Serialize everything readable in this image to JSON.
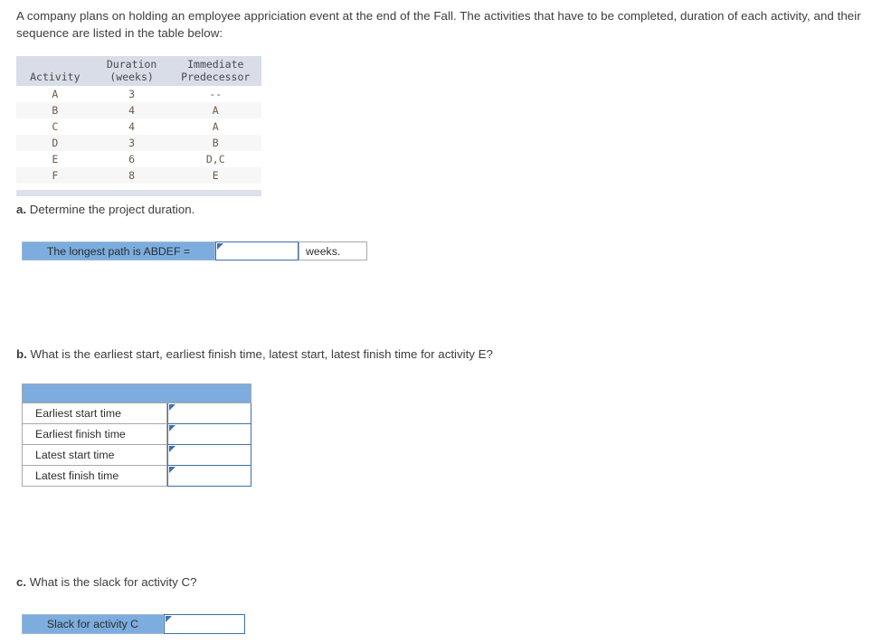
{
  "intro": {
    "paragraph": "A company plans on holding an employee appriciation event at the end of the Fall. The activities that have to be completed, duration of each activity, and their sequence are listed in the table below:"
  },
  "activity_table": {
    "headers": [
      "Activity",
      "Duration (weeks)",
      "Immediate Predecessor"
    ],
    "header_lines": {
      "activity": {
        "line1": "",
        "line2": "Activity"
      },
      "duration": {
        "line1": "Duration",
        "line2": "(weeks)"
      },
      "predecessor": {
        "line1": "Immediate",
        "line2": "Predecessor"
      }
    },
    "rows": [
      {
        "activity": "A",
        "duration": "3",
        "predecessor": "--"
      },
      {
        "activity": "B",
        "duration": "4",
        "predecessor": "A"
      },
      {
        "activity": "C",
        "duration": "4",
        "predecessor": "A"
      },
      {
        "activity": "D",
        "duration": "3",
        "predecessor": "B"
      },
      {
        "activity": "E",
        "duration": "6",
        "predecessor": "D,C"
      },
      {
        "activity": "F",
        "duration": "8",
        "predecessor": "E"
      }
    ]
  },
  "part_a": {
    "marker": "a.",
    "question": " Determine the project duration.",
    "label": "The longest path is ABDEF =",
    "input_value": "",
    "suffix": "weeks."
  },
  "part_b": {
    "marker": "b.",
    "question": " What is the earliest start, earliest finish time, latest start, latest finish time for activity E?",
    "header_label": "",
    "rows": [
      {
        "label": "Earliest start time",
        "value": ""
      },
      {
        "label": "Earliest finish time",
        "value": ""
      },
      {
        "label": "Latest start time",
        "value": ""
      },
      {
        "label": "Latest finish time",
        "value": ""
      }
    ]
  },
  "part_c": {
    "marker": "c.",
    "question": " What is the slack for activity C?",
    "label": "Slack for activity C",
    "input_value": ""
  },
  "colors": {
    "accent_blue": "#7cadde",
    "input_border_blue": "#3f6fab",
    "table_header_bg": "#d8dde8",
    "table_stripe": "#f7f7f7",
    "table_footer_bar": "#dde1ec",
    "text": "#3c3c3c"
  }
}
